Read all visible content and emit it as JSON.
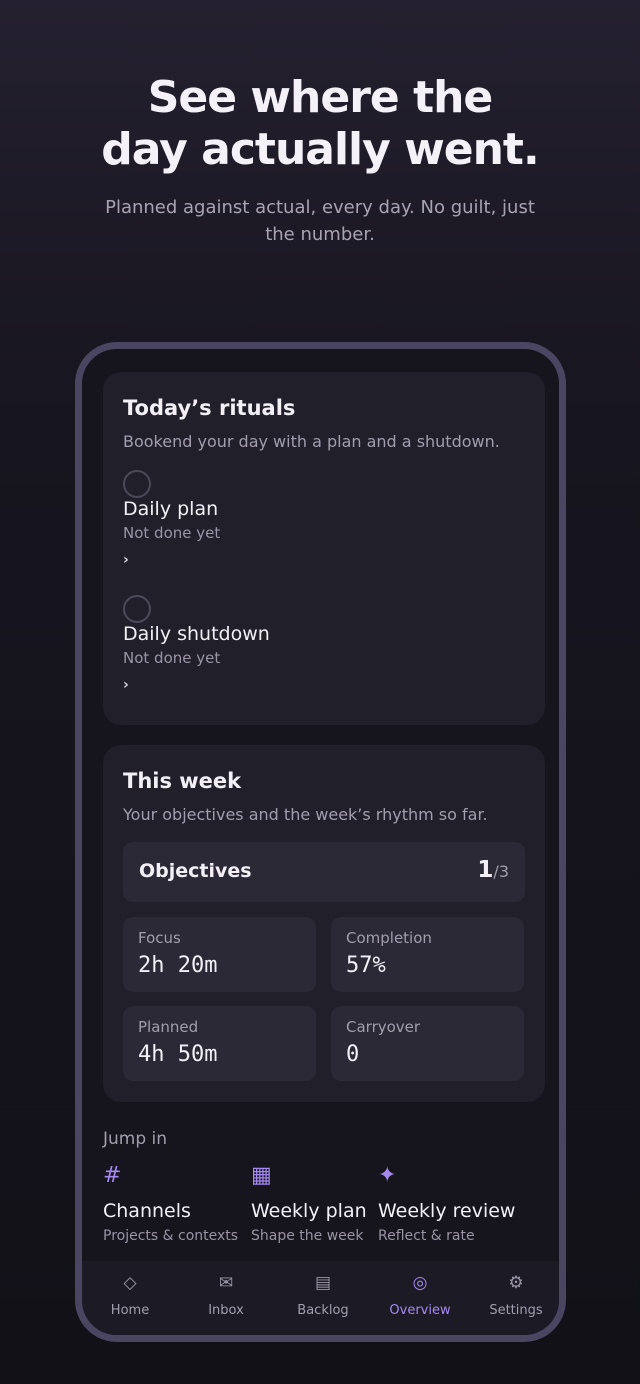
{
  "hero": {
    "title_line1": "See where the",
    "title_line2": "day actually went.",
    "subtitle": "Planned against actual, every day. No guilt, just the number."
  },
  "rituals": {
    "title": "Today’s rituals",
    "description": "Bookend your day with a plan and a shutdown.",
    "items": [
      {
        "title": "Daily plan",
        "status": "Not done yet",
        "chevron": "›"
      },
      {
        "title": "Daily shutdown",
        "status": "Not done yet",
        "chevron": "›"
      }
    ]
  },
  "week": {
    "title": "This week",
    "description": "Your objectives and the week’s rhythm so far.",
    "objectives_label": "Objectives",
    "objectives_done": "1",
    "objectives_total": "/3",
    "stats": [
      {
        "label": "Focus",
        "value": "2h 20m"
      },
      {
        "label": "Completion",
        "value": "57%"
      },
      {
        "label": "Planned",
        "value": "4h 50m"
      },
      {
        "label": "Carryover",
        "value": "0"
      }
    ]
  },
  "jump": {
    "label": "Jump in",
    "items": [
      {
        "icon": "#",
        "icon_name": "hash-icon",
        "title": "Channels",
        "subtitle": "Projects & contexts"
      },
      {
        "icon": "▦",
        "icon_name": "grid-icon",
        "title": "Weekly plan",
        "subtitle": "Shape the week"
      },
      {
        "icon": "✦",
        "icon_name": "sparkle-icon",
        "title": "Weekly review",
        "subtitle": "Reflect & rate"
      }
    ]
  },
  "tabs": [
    {
      "icon": "◇",
      "icon_name": "diamond-icon",
      "label": "Home",
      "active": false
    },
    {
      "icon": "✉",
      "icon_name": "inbox-icon",
      "label": "Inbox",
      "active": false
    },
    {
      "icon": "▤",
      "icon_name": "backlog-icon",
      "label": "Backlog",
      "active": false
    },
    {
      "icon": "◎",
      "icon_name": "overview-icon",
      "label": "Overview",
      "active": true
    },
    {
      "icon": "⚙",
      "icon_name": "settings-icon",
      "label": "Settings",
      "active": false
    }
  ],
  "colors": {
    "accent": "#a48af0",
    "background": "#16141d",
    "card": "#211f2a",
    "frame": "#4a4560"
  }
}
